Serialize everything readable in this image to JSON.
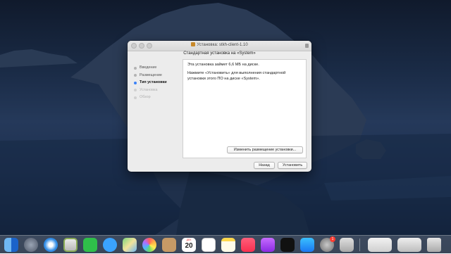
{
  "window": {
    "title": "Установка: stkh-client-1.10",
    "subtitle": "Стандартная установка на «System»"
  },
  "steps": [
    {
      "label": "Введение",
      "state": "done"
    },
    {
      "label": "Размещение",
      "state": "done"
    },
    {
      "label": "Тип установки",
      "state": "active"
    },
    {
      "label": "Установка",
      "state": "disabled"
    },
    {
      "label": "Обзор",
      "state": "disabled"
    }
  ],
  "content": {
    "line1": "Эта установка займет 6,6 МБ на диске.",
    "line2": "Нажмите «Установить» для выполнения стандартной установки этого ПО на диске «System»."
  },
  "buttons": {
    "change_location": "Изменить размещение установки...",
    "back": "Назад",
    "install": "Установить"
  },
  "dock": {
    "calendar_month": "ДЕК",
    "calendar_day": "20",
    "badge_count": "1",
    "icons": [
      "finder-icon",
      "launchpad-icon",
      "safari-icon",
      "photo-booth-icon",
      "facetime-icon",
      "messages-icon",
      "maps-icon",
      "photos-icon",
      "contacts-icon",
      "calendar-icon",
      "reminders-icon",
      "notes-icon",
      "music-icon",
      "podcasts-icon",
      "tv-icon",
      "app-store-icon",
      "system-preferences-icon",
      "installer-icon",
      "downloads-icon",
      "trash-icon"
    ]
  },
  "colors": {
    "accent": "#3b82f7",
    "window_bg": "#ececec",
    "desktop": "#1a2b46"
  }
}
